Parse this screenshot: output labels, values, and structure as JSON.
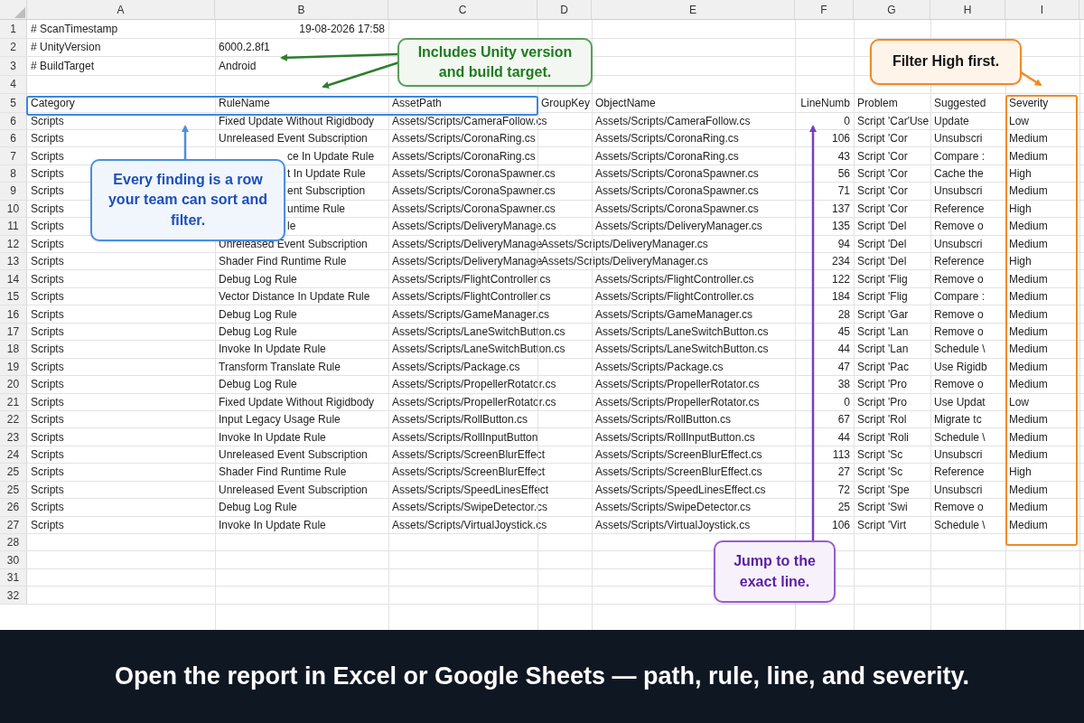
{
  "column_headers": [
    "A",
    "B",
    "C",
    "D",
    "E",
    "F",
    "G",
    "H",
    "I"
  ],
  "rows": [
    {
      "number": "1",
      "cells": {
        "A": "# ScanTimestamp",
        "B": {
          "text": "19-08-2026 17:58",
          "kind": "date"
        }
      }
    },
    {
      "number": "2",
      "cells": {
        "A": "# UnityVersion",
        "B": "6000.2.8f1"
      }
    },
    {
      "number": "3",
      "cells": {
        "A": "# BuildTarget",
        "B": "Android"
      }
    },
    {
      "number": "4"
    },
    {
      "number": "5",
      "cells": {
        "A": "Category",
        "B": "RuleName",
        "C": "AssetPath",
        "D": "GroupKey",
        "E": "ObjectName",
        "F": "LineNumb",
        "G": "Problem",
        "H": "Suggested",
        "I": "Severity"
      }
    },
    {
      "number": "6",
      "cells": {
        "A": "Scripts",
        "B": "Fixed Update Without Rigidbody",
        "C": "Assets/Scripts/CameraFollow.cs",
        "E": "Assets/Scripts/CameraFollow.cs",
        "F": "0",
        "G": "Script 'Car'Use",
        "H": "Update",
        "I": "Low"
      }
    },
    {
      "number": "6",
      "cells": {
        "A": "Scripts",
        "B": "Unreleased Event Subscription",
        "C": "Assets/Scripts/CoronaRing.cs",
        "E": "Assets/Scripts/CoronaRing.cs",
        "F": "106",
        "G": "Script 'Cor",
        "H": "Unsubscri",
        "I": "Medium"
      }
    },
    {
      "number": "7",
      "cells": {
        "A": "Scripts",
        "B": {
          "text": "ce In Update Rule",
          "covered": true
        },
        "C": "Assets/Scripts/CoronaRing.cs",
        "E": "Assets/Scripts/CoronaRing.cs",
        "F": "43",
        "G": "Script 'Cor",
        "H": "Compare :",
        "I": "Medium"
      }
    },
    {
      "number": "8",
      "cells": {
        "A": "Scripts",
        "B": {
          "text": "t In Update Rule",
          "covered": true
        },
        "C": "Assets/Scripts/CoronaSpawner.cs",
        "E": "Assets/Scripts/CoronaSpawner.cs",
        "F": "56",
        "G": "Script 'Cor",
        "H": "Cache the",
        "I": "High"
      }
    },
    {
      "number": "9",
      "cells": {
        "A": "Scripts",
        "B": {
          "text": "ent Subscription",
          "covered": true
        },
        "C": "Assets/Scripts/CoronaSpawner.cs",
        "E": "Assets/Scripts/CoronaSpawner.cs",
        "F": "71",
        "G": "Script 'Cor",
        "H": "Unsubscri",
        "I": "Medium"
      }
    },
    {
      "number": "10",
      "cells": {
        "A": "Scripts",
        "B": {
          "text": "untime Rule",
          "covered": true
        },
        "C": "Assets/Scripts/CoronaSpawner.cs",
        "E": "Assets/Scripts/CoronaSpawner.cs",
        "F": "137",
        "G": "Script 'Cor",
        "H": "Reference",
        "I": "High"
      }
    },
    {
      "number": "11",
      "cells": {
        "A": "Scripts",
        "B": {
          "text": "le",
          "covered": true
        },
        "C": "Assets/Scripts/DeliveryManage.cs",
        "E": "Assets/Scripts/DeliveryManager.cs",
        "F": "135",
        "G": "Script 'Del",
        "H": "Remove o",
        "I": "Medium"
      }
    },
    {
      "number": "12",
      "cells": {
        "A": "Scripts",
        "B": "Unreleased Event Subscription",
        "C": "Assets/Scripts/DeliveryManage",
        "D": "Assets/Scripts/DeliveryManager.cs",
        "F": "94",
        "G": "Script 'Del",
        "H": "Unsubscri",
        "I": "Medium"
      }
    },
    {
      "number": "13",
      "cells": {
        "A": "Scripts",
        "B": "Shader Find Runtime Rule",
        "C": "Assets/Scripts/DeliveryManage",
        "D": "Assets/Scripts/DeliveryManager.cs",
        "F": "234",
        "G": "Script 'Del",
        "H": "Reference",
        "I": "High"
      }
    },
    {
      "number": "14",
      "cells": {
        "A": "Scripts",
        "B": "Debug Log Rule",
        "C": "Assets/Scripts/FlightController.cs",
        "E": "Assets/Scripts/FlightController.cs",
        "F": "122",
        "G": "Script 'Flig",
        "H": "Remove o",
        "I": "Medium"
      }
    },
    {
      "number": "15",
      "cells": {
        "A": "Scripts",
        "B": "Vector Distance In Update Rule",
        "C": "Assets/Scripts/FlightController.cs",
        "E": "Assets/Scripts/FlightController.cs",
        "F": "184",
        "G": "Script 'Flig",
        "H": "Compare :",
        "I": "Medium"
      }
    },
    {
      "number": "16",
      "cells": {
        "A": "Scripts",
        "B": "Debug Log Rule",
        "C": "Assets/Scripts/GameManager.cs",
        "E": "Assets/Scripts/GameManager.cs",
        "F": "28",
        "G": "Script 'Gar",
        "H": "Remove o",
        "I": "Medium"
      }
    },
    {
      "number": "17",
      "cells": {
        "A": "Scripts",
        "B": "Debug Log Rule",
        "C": "Assets/Scripts/LaneSwitchButton.cs",
        "E": "Assets/Scripts/LaneSwitchButton.cs",
        "F": "45",
        "G": "Script 'Lan",
        "H": "Remove o",
        "I": "Medium"
      }
    },
    {
      "number": "18",
      "cells": {
        "A": "Scripts",
        "B": "Invoke In Update Rule",
        "C": "Assets/Scripts/LaneSwitchButton.cs",
        "E": "Assets/Scripts/LaneSwitchButton.cs",
        "F": "44",
        "G": "Script 'Lan",
        "H": "Schedule \\",
        "I": "Medium"
      }
    },
    {
      "number": "19",
      "cells": {
        "A": "Scripts",
        "B": "Transform Translate Rule",
        "C": "Assets/Scripts/Package.cs",
        "E": "Assets/Scripts/Package.cs",
        "F": "47",
        "G": "Script 'Pac",
        "H": "Use Rigidb",
        "I": "Medium"
      }
    },
    {
      "number": "20",
      "cells": {
        "A": "Scripts",
        "B": "Debug Log Rule",
        "C": "Assets/Scripts/PropellerRotator.cs",
        "E": "Assets/Scripts/PropellerRotator.cs",
        "F": "38",
        "G": "Script 'Pro",
        "H": "Remove o",
        "I": "Medium"
      }
    },
    {
      "number": "21",
      "cells": {
        "A": "Scripts",
        "B": "Fixed Update Without Rigidbody",
        "C": "Assets/Scripts/PropellerRotator.cs",
        "E": "Assets/Scripts/PropellerRotator.cs",
        "F": "0",
        "G": "Script 'Pro",
        "H": "Use Updat",
        "I": "Low"
      }
    },
    {
      "number": "22",
      "cells": {
        "A": "Scripts",
        "B": "Input Legacy Usage Rule",
        "C": "Assets/Scripts/RollButton.cs",
        "E": "Assets/Scripts/RollButton.cs",
        "F": "67",
        "G": "Script 'Rol",
        "H": "Migrate tc",
        "I": "Medium"
      }
    },
    {
      "number": "23",
      "cells": {
        "A": "Scripts",
        "B": "Invoke In Update Rule",
        "C": "Assets/Scripts/RollInputButton",
        "E": "Assets/Scripts/RollInputButton.cs",
        "F": "44",
        "G": "Script 'Roli",
        "H": "Schedule \\",
        "I": "Medium"
      }
    },
    {
      "number": "24",
      "cells": {
        "A": "Scripts",
        "B": "Unreleased Event Subscription",
        "C": "Assets/Scripts/ScreenBlurEffect",
        "E": "Assets/Scripts/ScreenBlurEffect.cs",
        "F": "113",
        "G": "Script 'Sc",
        "H": "Unsubscri",
        "I": "Medium"
      }
    },
    {
      "number": "25",
      "cells": {
        "A": "Scripts",
        "B": "Shader Find Runtime Rule",
        "C": "Assets/Scripts/ScreenBlurEffect",
        "E": "Assets/Scripts/ScreenBlurEffect.cs",
        "F": "27",
        "G": "Script 'Sc",
        "H": "Reference",
        "I": "High"
      }
    },
    {
      "number": "25",
      "cells": {
        "A": "Scripts",
        "B": "Unreleased Event Subscription",
        "C": "Assets/Scripts/SpeedLinesEffect",
        "E": "Assets/Scripts/SpeedLinesEffect.cs",
        "F": "72",
        "G": "Script 'Spe",
        "H": "Unsubscri",
        "I": "Medium"
      }
    },
    {
      "number": "26",
      "cells": {
        "A": "Scripts",
        "B": "Debug Log Rule",
        "C": "Assets/Scripts/SwipeDetector.cs",
        "E": "Assets/Scripts/SwipeDetector.cs",
        "F": "25",
        "G": "Script 'Swi",
        "H": "Remove o",
        "I": "Medium"
      }
    },
    {
      "number": "27",
      "cells": {
        "A": "Scripts",
        "B": "Invoke In Update Rule",
        "C": "Assets/Scripts/VirtualJoystick.cs",
        "E": "Assets/Scripts/VirtualJoystick.cs",
        "F": "106",
        "G": "Script 'Virt",
        "H": "Schedule \\",
        "I": "Medium"
      }
    },
    {
      "number": "28"
    },
    {
      "number": "30"
    },
    {
      "number": "31"
    },
    {
      "number": "32"
    }
  ],
  "callouts": [
    {
      "kind": "green",
      "text": "Includes Unity version and build target."
    },
    {
      "kind": "blue",
      "text": "Every finding is a row your team can sort and filter."
    },
    {
      "kind": "orange",
      "text": "Filter High first."
    },
    {
      "kind": "purple",
      "text": "Jump to the exact line."
    }
  ],
  "caption": "Open the report in Excel or Google Sheets — path, rule, line, and severity."
}
